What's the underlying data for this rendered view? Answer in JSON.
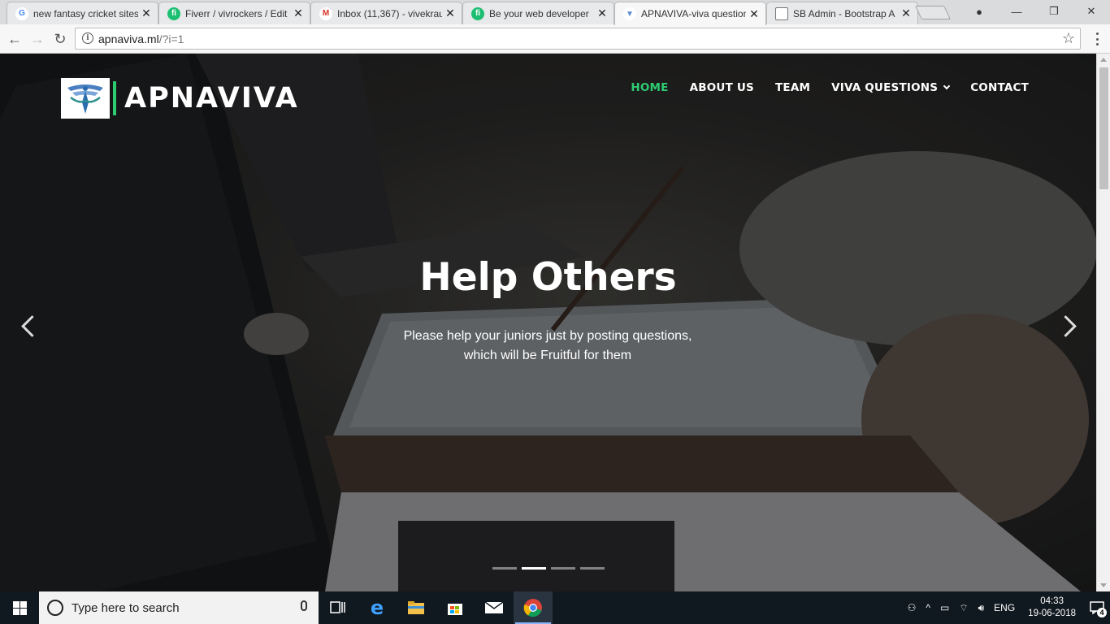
{
  "browser": {
    "tabs": [
      {
        "title": "new fantasy cricket sites",
        "favicon": "google-icon",
        "favicon_color": "#4285f4",
        "favicon_glyph": "G",
        "active": false
      },
      {
        "title": "Fiverr / vivrockers / Edit",
        "favicon": "fiverr-icon",
        "favicon_color": "#1dbf73",
        "favicon_glyph": "fi",
        "active": false
      },
      {
        "title": "Inbox (11,367) - vivekrau",
        "favicon": "gmail-icon",
        "favicon_color": "#d93025",
        "favicon_glyph": "M",
        "active": false
      },
      {
        "title": "Be your web developer",
        "favicon": "fiverr-icon",
        "favicon_color": "#1dbf73",
        "favicon_glyph": "fi",
        "active": false
      },
      {
        "title": "APNAVIVA-viva question",
        "favicon": "apnaviva-icon",
        "favicon_color": "#5b8bd0",
        "favicon_glyph": "▼",
        "active": true
      },
      {
        "title": "SB Admin - Bootstrap A",
        "favicon": "page-icon",
        "favicon_color": "#777777",
        "favicon_glyph": "▢",
        "active": false
      }
    ],
    "url_host": "apnaviva.ml",
    "url_path": "/?i=1"
  },
  "site": {
    "brand": "APNAVIVA",
    "nav": [
      {
        "label": "HOME",
        "active": true
      },
      {
        "label": "ABOUT US",
        "active": false
      },
      {
        "label": "TEAM",
        "active": false
      },
      {
        "label": "VIVA QUESTIONS",
        "active": false,
        "dropdown": true
      },
      {
        "label": "CONTACT",
        "active": false
      }
    ],
    "slide": {
      "title": "Help Others",
      "text": "Please help your juniors just by posting questions, which will be Fruitful for them"
    },
    "indicators": {
      "count": 4,
      "active_index": 1
    }
  },
  "taskbar": {
    "search_placeholder": "Type here to search",
    "language": "ENG",
    "time": "04:33",
    "date": "19-06-2018",
    "notification_count": "4"
  },
  "colors": {
    "accent_green": "#2ecc71",
    "taskbar": "#101820"
  }
}
